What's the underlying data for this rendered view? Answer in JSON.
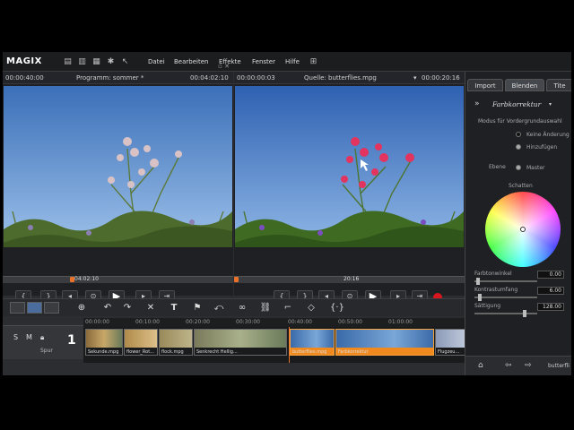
{
  "app": {
    "logo": "MAGIX",
    "menu": [
      "Datei",
      "Bearbeiten",
      "Effekte",
      "Fenster",
      "Hilfe"
    ],
    "toolbar_icons": [
      "new-icon",
      "open-icon",
      "save-icon",
      "tools-icon",
      "help-cursor-icon"
    ]
  },
  "program_monitor": {
    "timecode_left": "00:00:40:00",
    "title": "Programm: sommer *",
    "timecode_right": "00:04:02:10",
    "ruler_timecode": "04:02:10",
    "position": 0.3
  },
  "source_monitor": {
    "timecode_left": "00:00:00:03",
    "title": "Quelle: butterflies.mpg",
    "timecode_right": "00:00:20:16",
    "ruler_timecode": "20:16",
    "position": 0.0
  },
  "timeline": {
    "ruler_ticks": [
      "00:00:00",
      "00:10:00",
      "00:20:00",
      "00:30:00",
      "00:40:00",
      "00:50:00",
      "01:00:00"
    ],
    "track": {
      "solo": "S",
      "mute": "M",
      "number": "1",
      "label": "Spur"
    },
    "clips": [
      {
        "name": "Sekunde.mpg"
      },
      {
        "name": "flower_Rot..."
      },
      {
        "name": "flock.mpg"
      },
      {
        "name": "Senkrecht Hellig..."
      },
      {
        "name": "butterflies.mpg",
        "selected": true
      },
      {
        "name": "Farbkorrektur",
        "selected": true
      },
      {
        "name": "Flugzeu..."
      }
    ]
  },
  "right_panel": {
    "tabs": [
      "Import",
      "Blenden",
      "Tite"
    ],
    "section_title": "Farbkorrektur",
    "mode_label": "Modus für Vordergrundauswahl",
    "radio_options": [
      "Keine Änderung",
      "Hinzufügen"
    ],
    "ebene_label": "Ebene",
    "ebene_value": "Master",
    "schatten_label": "Schatten",
    "sliders": [
      {
        "label": "Farbtonwinkel",
        "value": "0.00"
      },
      {
        "label": "Kontrastumfang",
        "value": "6.00"
      },
      {
        "label": "Sättigung",
        "value": "128.00"
      }
    ],
    "footer_text": "butterfli",
    "accent": "#f08a1e"
  }
}
